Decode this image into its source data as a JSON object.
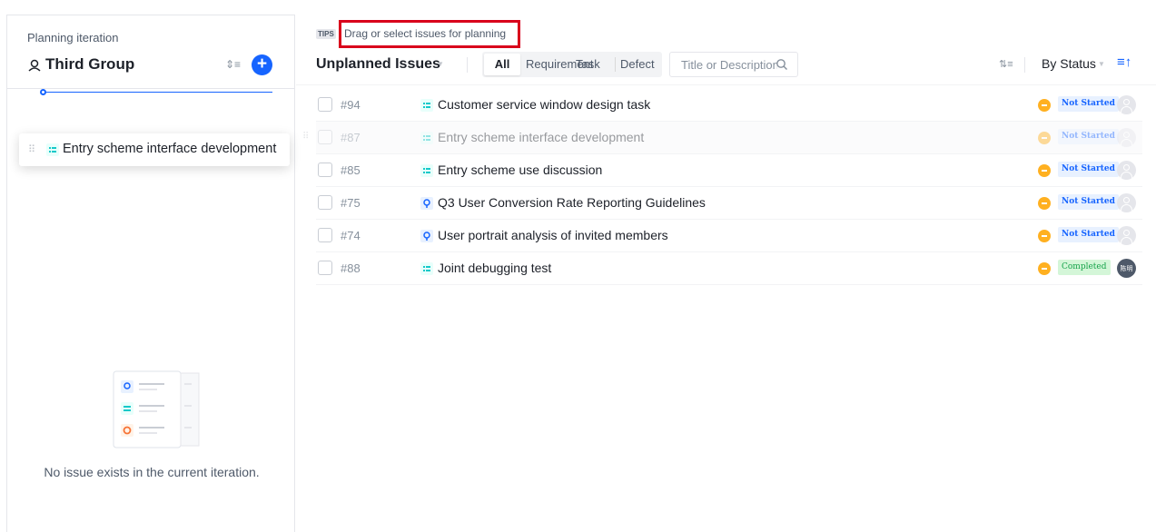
{
  "left_panel": {
    "caption": "Planning iteration",
    "group_name": "Third Group",
    "icons": {
      "group": "team-icon",
      "sort": "sort-icon",
      "add": "plus-icon"
    },
    "dragging_item": {
      "title": "Entry scheme interface development",
      "type": "task"
    },
    "empty_message": "No issue exists in the current iteration."
  },
  "right_panel": {
    "tips": {
      "badge": "TIPS",
      "text": "Drag or select issues for planning"
    },
    "toolbar": {
      "title": "Unplanned Issues",
      "filters": [
        {
          "label": "All",
          "selected": true
        },
        {
          "label": "Requirement",
          "selected": false
        },
        {
          "label": "Task",
          "selected": false
        },
        {
          "label": "Defect",
          "selected": false
        }
      ],
      "search_placeholder": "Title or Description",
      "group_by": "By Status",
      "icons": {
        "expand": "collapse-expand-icon",
        "sort": "sort-ascending-icon",
        "search": "search-icon"
      }
    },
    "issues": [
      {
        "id": "#94",
        "type": "task",
        "title": "Customer service window design task",
        "status": "Not Started",
        "status_kind": "not-started",
        "avatar": ""
      },
      {
        "id": "#87",
        "type": "task",
        "title": "Entry scheme interface development",
        "status": "Not Started",
        "status_kind": "not-started",
        "avatar": "",
        "ghost": true
      },
      {
        "id": "#85",
        "type": "task",
        "title": "Entry scheme use discussion",
        "status": "Not Started",
        "status_kind": "not-started",
        "avatar": ""
      },
      {
        "id": "#75",
        "type": "requirement",
        "title": "Q3 User Conversion Rate Reporting Guidelines",
        "status": "Not Started",
        "status_kind": "not-started",
        "avatar": ""
      },
      {
        "id": "#74",
        "type": "requirement",
        "title": "User portrait analysis of invited members",
        "status": "Not Started",
        "status_kind": "not-started",
        "avatar": ""
      },
      {
        "id": "#88",
        "type": "task",
        "title": "Joint debugging test",
        "status": "Completed",
        "status_kind": "completed",
        "avatar": "陈明"
      }
    ]
  },
  "colors": {
    "accent": "#1664ff",
    "task_icon": "#14c9c9",
    "requirement_icon": "#1664ff",
    "defect_icon": "#f77234",
    "priority": "#ffb020",
    "highlight": "#d9001b"
  }
}
